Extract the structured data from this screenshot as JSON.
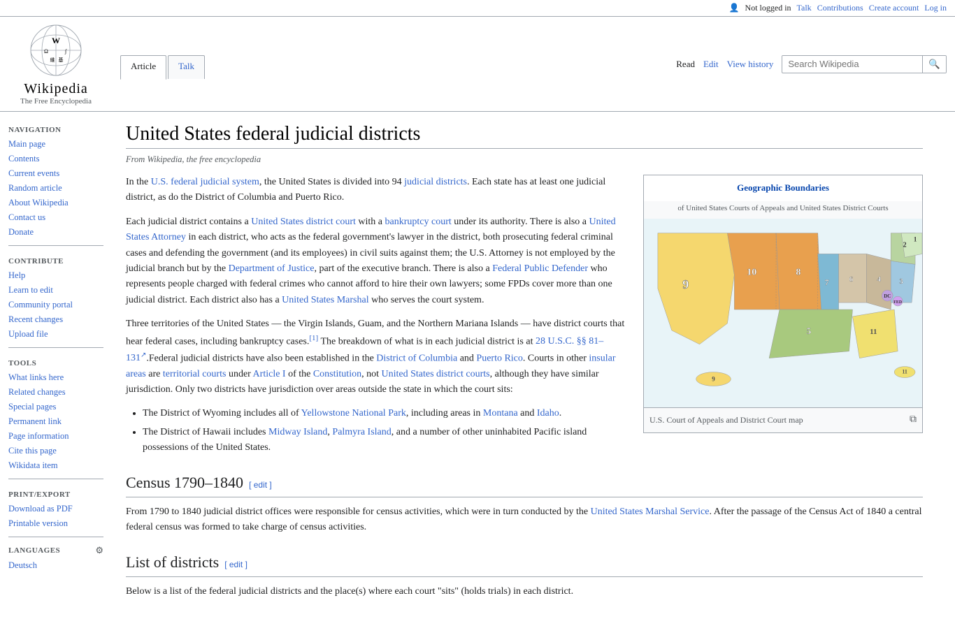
{
  "topbar": {
    "not_logged_in": "Not logged in",
    "talk": "Talk",
    "contributions": "Contributions",
    "create_account": "Create account",
    "log_in": "Log in"
  },
  "logo": {
    "site_name": "Wikipedia",
    "tagline": "The Free Encyclopedia"
  },
  "tabs": {
    "article": "Article",
    "talk": "Talk",
    "read": "Read",
    "edit": "Edit",
    "view_history": "View history"
  },
  "search": {
    "placeholder": "Search Wikipedia"
  },
  "sidebar": {
    "nav_title": "Navigation",
    "main_page": "Main page",
    "contents": "Contents",
    "current_events": "Current events",
    "random_article": "Random article",
    "about": "About Wikipedia",
    "contact": "Contact us",
    "donate": "Donate",
    "contribute_title": "Contribute",
    "help": "Help",
    "learn": "Learn to edit",
    "community": "Community portal",
    "recent": "Recent changes",
    "upload": "Upload file",
    "tools_title": "Tools",
    "what_links": "What links here",
    "related": "Related changes",
    "special": "Special pages",
    "permanent": "Permanent link",
    "page_info": "Page information",
    "cite": "Cite this page",
    "wikidata": "Wikidata item",
    "print_title": "Print/export",
    "download": "Download as PDF",
    "printable": "Printable version",
    "languages_title": "Languages",
    "deutsch": "Deutsch"
  },
  "page": {
    "title": "United States federal judicial districts",
    "subtitle": "From Wikipedia, the free encyclopedia",
    "intro_p1_start": "In the ",
    "us_federal": "U.S. federal judicial system",
    "intro_p1_mid": ", the United States is divided into 94 ",
    "judicial_districts": "judicial districts",
    "intro_p1_end": ". Each state has at least one judicial district, as do the District of Columbia and Puerto Rico.",
    "intro_p2_start": "Each judicial district contains a ",
    "district_court": "United States district court",
    "intro_p2_mid1": " with a ",
    "bankruptcy_court": "bankruptcy court",
    "intro_p2_mid2": " under its authority. There is also a ",
    "us_attorney": "United States Attorney",
    "intro_p2_mid3": " in each district, who acts as the federal government's lawyer in the district, both prosecuting federal criminal cases and defending the government (and its employees) in civil suits against them; the U.S. Attorney is not employed by the judicial branch but by the ",
    "doj": "Department of Justice",
    "intro_p2_mid4": ", part of the executive branch. There is also a ",
    "fpd": "Federal Public Defender",
    "intro_p2_mid5": " who represents people charged with federal crimes who cannot afford to hire their own lawyers; some FPDs cover more than one judicial district. Each district also has a ",
    "usm": "United States Marshal",
    "intro_p2_end": " who serves the court system.",
    "intro_p3_start": "Three territories of the United States — the Virgin Islands, Guam, and the Northern Mariana Islands — have district courts that hear federal cases, including bankruptcy cases.",
    "ref1": "[1]",
    "intro_p3_mid": " The breakdown of what is in each judicial district is at ",
    "usc_link": "28 U.S.C. §§ 81–131",
    "intro_p3_mid2": ".Federal judicial districts have also been established in the ",
    "dc_link": "District of Columbia",
    "intro_p3_mid3": " and ",
    "pr_link": "Puerto Rico",
    "intro_p3_mid4": ". Courts in other ",
    "insular_link": "insular areas",
    "intro_p3_mid5": " are ",
    "territorial_link": "territorial courts",
    "intro_p3_mid6": " under ",
    "article1_link": "Article I",
    "intro_p3_mid7": " of the ",
    "constitution_link": "Constitution",
    "intro_p3_end": ", not ",
    "usdc_link": "United States district courts",
    "intro_p3_end2": ", although they have similar jurisdiction. Only two districts have jurisdiction over areas outside the state in which the court sits:",
    "bullet1_start": "The District of Wyoming includes all of ",
    "yellowstone_link": "Yellowstone National Park",
    "bullet1_mid": ", including areas in ",
    "montana_link": "Montana",
    "bullet1_mid2": " and ",
    "idaho_link": "Idaho",
    "bullet1_end": ".",
    "bullet2_start": "The District of Hawaii includes ",
    "midway_link": "Midway Island",
    "bullet2_mid": ", ",
    "palmyra_link": "Palmyra Island",
    "bullet2_end": ", and a number of other uninhabited Pacific island possessions of the United States.",
    "section2_title": "Census 1790–1840",
    "section2_edit": "[ edit ]",
    "census_p": "From 1790 to 1840 judicial district offices were responsible for census activities, which were in turn conducted by the ",
    "usms_link": "United States Marshal Service",
    "census_p_end": ". After the passage of the Census Act of 1840 a central federal census was formed to take charge of census activities.",
    "section3_title": "List of districts",
    "section3_edit": "[ edit ]",
    "list_p": "Below is a list of the federal judicial districts and the place(s) where each court \"sits\" (holds trials) in each district."
  },
  "mapbox": {
    "title": "Geographic Boundaries",
    "subtitle": "of United States Courts of Appeals and United States District Courts",
    "caption": "U.S. Court of Appeals and District Court map"
  }
}
